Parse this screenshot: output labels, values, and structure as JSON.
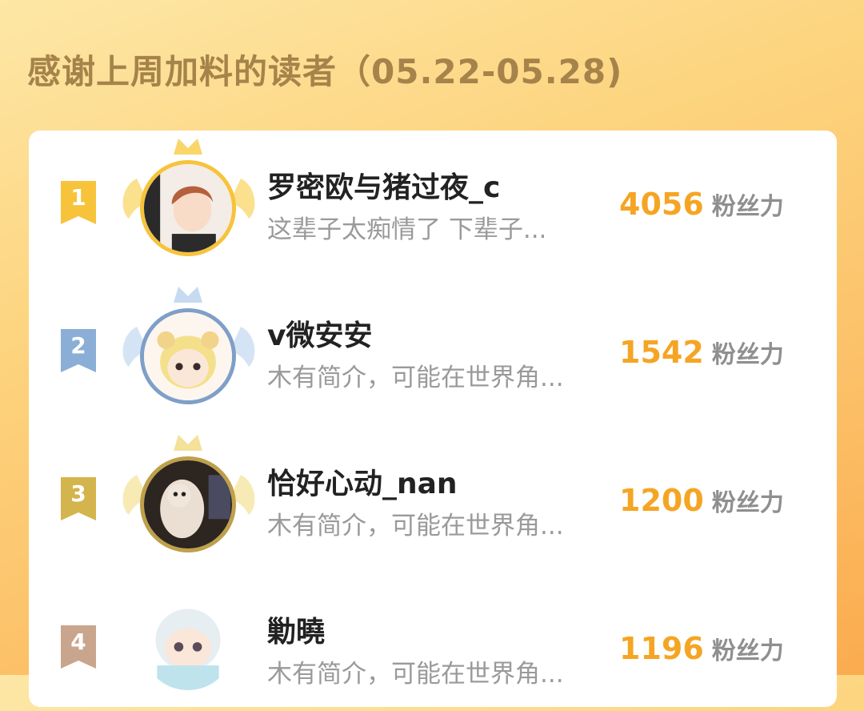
{
  "header": {
    "title": "感谢上周加料的读者（05.22-05.28)"
  },
  "colors": {
    "gold": "#f6c33b",
    "silver_blue": "#8aaed6",
    "bronze": "#d4b44c",
    "fourth": "#c9a58d",
    "score": "#f5a524"
  },
  "ranking": [
    {
      "rank": "1",
      "name": "罗密欧与猪过夜_c",
      "bio": "这辈子太痴情了 下辈子...",
      "score": "4056",
      "unit": "粉丝力"
    },
    {
      "rank": "2",
      "name": "v微安安",
      "bio": "木有简介，可能在世界角...",
      "score": "1542",
      "unit": "粉丝力"
    },
    {
      "rank": "3",
      "name": "恰好心动_nan",
      "bio": "木有简介，可能在世界角...",
      "score": "1200",
      "unit": "粉丝力"
    },
    {
      "rank": "4",
      "name": "勦曉",
      "bio": "木有简介，可能在世界角...",
      "score": "1196",
      "unit": "粉丝力"
    }
  ]
}
